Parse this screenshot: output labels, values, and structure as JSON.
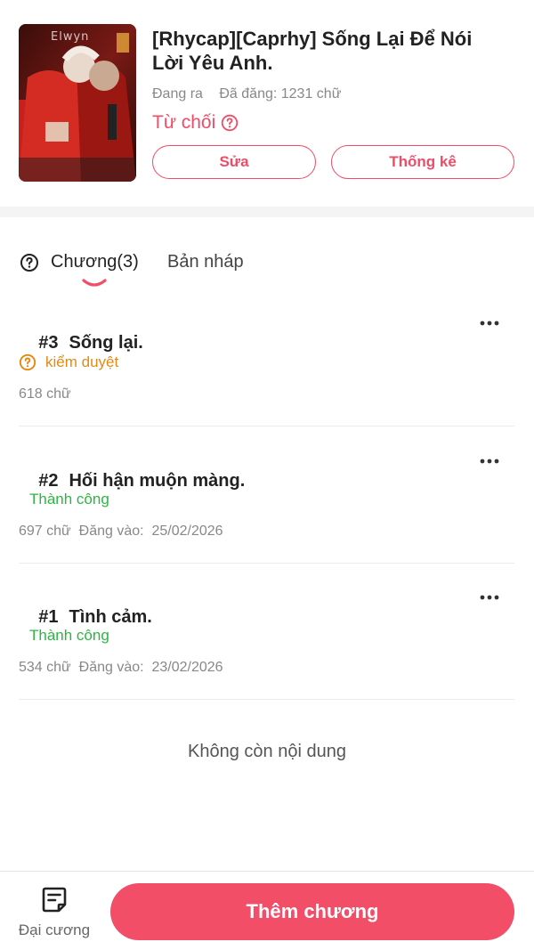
{
  "story": {
    "title": "[Rhycap][Caprhy] Sống Lại Để Nói Lời Yêu Anh.",
    "cover_watermark": "Elwyn",
    "status": "Đang ra",
    "posted": "Đã đăng: 1231 chữ",
    "review_status": "Từ chối",
    "edit_label": "Sửa",
    "stats_label": "Thống kê"
  },
  "tabs": {
    "chapters": "Chương(3)",
    "drafts": "Bản nháp"
  },
  "chapters": [
    {
      "number": "#3",
      "title": "Sống lại.",
      "status": "kiểm duyệt",
      "info": "618 chữ"
    },
    {
      "number": "#2",
      "title": "Hối hận muộn màng.",
      "status": "Thành công",
      "info": "697 chữ  Đăng vào:  25/02/2026"
    },
    {
      "number": "#1",
      "title": "Tình cảm.",
      "status": "Thành công",
      "info": "534 chữ  Đăng vào:  23/02/2026"
    }
  ],
  "no_more": "Không còn nội dung",
  "bottom": {
    "outline_label": "Đại cương",
    "add_chapter_label": "Thêm chương"
  },
  "colors": {
    "accent": "#f24e68",
    "pending": "#e28a12",
    "success": "#2fb543",
    "muted": "#888888"
  }
}
